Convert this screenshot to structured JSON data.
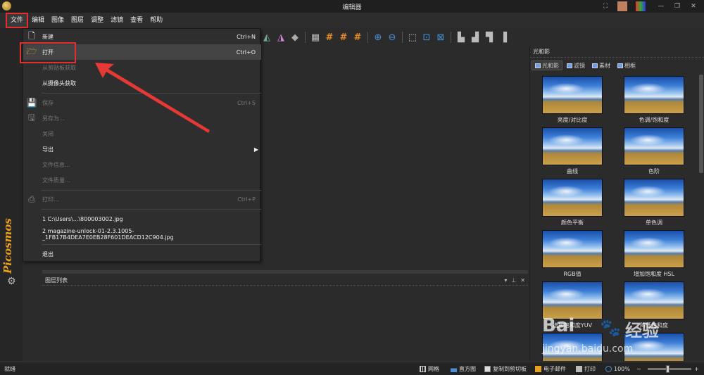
{
  "window": {
    "title": "编辑器"
  },
  "menubar": {
    "items": [
      "文件",
      "编辑",
      "图像",
      "图层",
      "调整",
      "滤镜",
      "查看",
      "帮助"
    ]
  },
  "file_menu": {
    "items": [
      {
        "label": "新建",
        "shortcut": "Ctrl+N",
        "disabled": false,
        "icon": "new-file-icon"
      },
      {
        "label": "打开",
        "shortcut": "Ctrl+O",
        "disabled": false,
        "icon": "folder-open-icon"
      },
      {
        "label": "从剪贴板获取",
        "shortcut": "",
        "disabled": true,
        "icon": ""
      },
      {
        "label": "从摄像头获取",
        "shortcut": "",
        "disabled": false,
        "icon": ""
      },
      {
        "label": "保存",
        "shortcut": "Ctrl+S",
        "disabled": true,
        "icon": "save-icon"
      },
      {
        "label": "另存为...",
        "shortcut": "",
        "disabled": true,
        "icon": "save-as-icon"
      },
      {
        "label": "关闭",
        "shortcut": "",
        "disabled": true,
        "icon": ""
      },
      {
        "label": "导出",
        "shortcut": "",
        "disabled": false,
        "icon": ""
      },
      {
        "label": "文件信息...",
        "shortcut": "",
        "disabled": true,
        "icon": ""
      },
      {
        "label": "文件质量...",
        "shortcut": "",
        "disabled": true,
        "icon": ""
      },
      {
        "label": "打印...",
        "shortcut": "Ctrl+P",
        "disabled": true,
        "icon": "printer-icon"
      },
      {
        "label": "1 C:\\Users\\...\\800003002.jpg",
        "shortcut": "",
        "disabled": false,
        "icon": ""
      },
      {
        "label": "2 magazine-unlock-01-2.3.1005-_1FB17B4DEA7E0EB28F601DEACD12C904.jpg",
        "shortcut": "",
        "disabled": false,
        "icon": ""
      },
      {
        "label": "退出",
        "shortcut": "",
        "disabled": false,
        "icon": ""
      }
    ]
  },
  "side_brand": "Picosmos",
  "layers_panel": {
    "title": "图层列表"
  },
  "right_panel": {
    "title": "光和影",
    "tabs": [
      "光和影",
      "滤镜",
      "素材",
      "相框"
    ],
    "thumbnails": [
      "亮度/对比度",
      "色调/饱和度",
      "曲线",
      "色阶",
      "颜色平衡",
      "单色调",
      "RGB值",
      "增加饱和度 HSL",
      "增加饱和度YUV",
      "降低饱和度"
    ]
  },
  "statusbar": {
    "status": "就绪",
    "grid": "网格",
    "histogram": "直方图",
    "copy": "复制到剪切板",
    "email": "电子邮件",
    "print": "打印",
    "zoom": "100%"
  },
  "watermark": {
    "brand": "Bai",
    "brand2": "经验",
    "url": "jingyan.baidu.com"
  },
  "colors": {
    "accent_red": "#e03030",
    "hash_orange": "#e88a20",
    "zoom_blue": "#4a90d9"
  }
}
